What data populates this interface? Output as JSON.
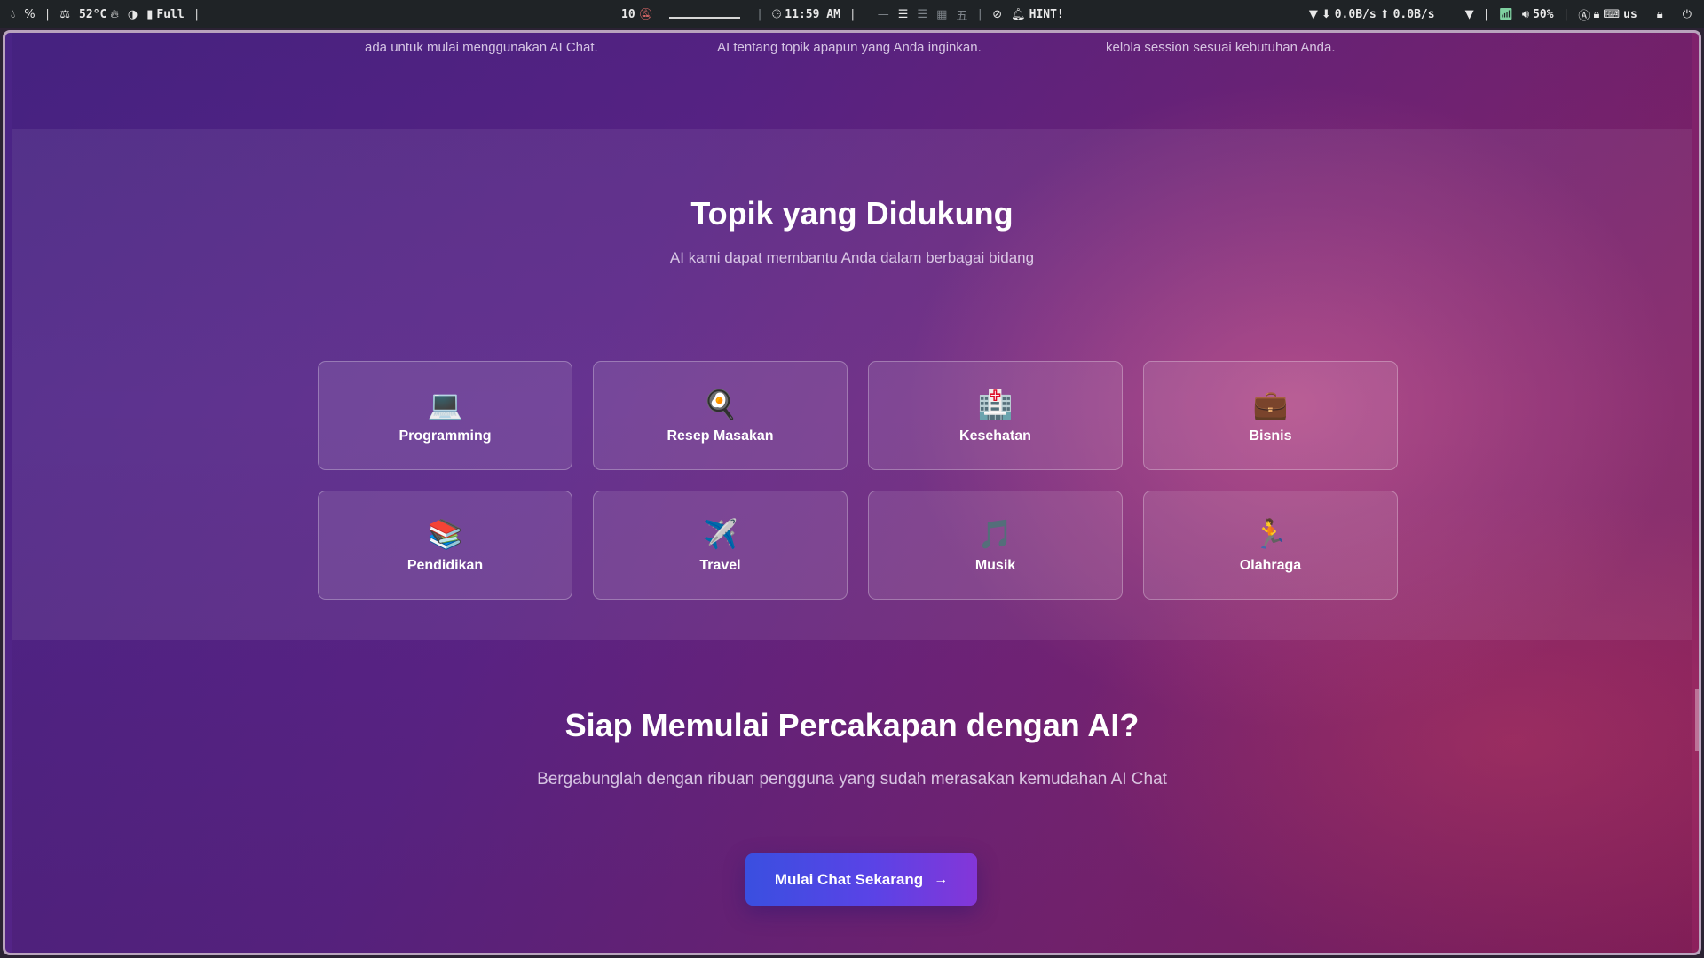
{
  "statusbar": {
    "left": {
      "temperature": "52°C",
      "battery_status": "Full"
    },
    "center": {
      "workspace": "10",
      "clock": "11:59 AM",
      "hint": "HINT!"
    },
    "right": {
      "net_down": "0.0B/s",
      "net_up": "0.0B/s",
      "volume": "50%",
      "keyboard_layout": "us"
    },
    "icons": [
      "drop-icon",
      "percent-icon",
      "scale-icon",
      "flame-icon",
      "contrast-icon",
      "battery-icon",
      "bell-off-icon",
      "clock-icon",
      "layout-icons",
      "eye-off-icon",
      "bell-icon",
      "wifi-icon",
      "download-icon",
      "upload-icon",
      "wifi-status-icon",
      "volume-icon",
      "lock-icon",
      "power-icon"
    ]
  },
  "features_tail": {
    "texts": [
      "ada untuk mulai menggunakan AI Chat.",
      "AI tentang topik apapun yang Anda inginkan.",
      "kelola session sesuai kebutuhan Anda."
    ]
  },
  "topics": {
    "title": "Topik yang Didukung",
    "subtitle": "AI kami dapat membantu Anda dalam berbagai bidang",
    "items": [
      {
        "label": "Programming",
        "icon": "💻",
        "icon_name": "laptop-icon"
      },
      {
        "label": "Resep Masakan",
        "icon": "🍳",
        "icon_name": "cooking-icon"
      },
      {
        "label": "Kesehatan",
        "icon": "🏥",
        "icon_name": "hospital-icon"
      },
      {
        "label": "Bisnis",
        "icon": "💼",
        "icon_name": "briefcase-icon"
      },
      {
        "label": "Pendidikan",
        "icon": "📚",
        "icon_name": "books-icon"
      },
      {
        "label": "Travel",
        "icon": "✈️",
        "icon_name": "airplane-icon"
      },
      {
        "label": "Musik",
        "icon": "🎵",
        "icon_name": "music-note-icon"
      },
      {
        "label": "Olahraga",
        "icon": "🏃",
        "icon_name": "runner-icon"
      }
    ]
  },
  "cta": {
    "title": "Siap Memulai Percakapan dengan AI?",
    "subtitle": "Bergabunglah dengan ribuan pengguna yang sudah merasakan kemudahan AI Chat",
    "button_label": "Mulai Chat Sekarang",
    "button_arrow": "→"
  },
  "colors": {
    "bg_start": "#4a2486",
    "bg_end": "#8a1f5c",
    "button_start": "#3a4fe0",
    "button_end": "#8436d8",
    "statusbar": "#1f2326"
  }
}
